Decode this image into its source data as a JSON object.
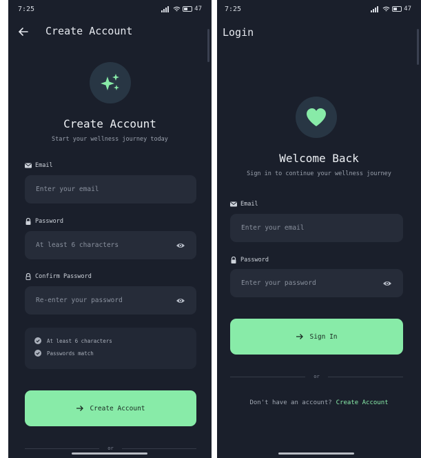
{
  "left": {
    "status": {
      "time": "7:25",
      "battery": "47"
    },
    "appbar": {
      "title": "Create Account"
    },
    "hero": {
      "title": "Create Account",
      "subtitle": "Start your wellness journey today"
    },
    "email": {
      "label": "Email",
      "placeholder": "Enter your email"
    },
    "password": {
      "label": "Password",
      "placeholder": "At least 6 characters"
    },
    "confirm": {
      "label": "Confirm Password",
      "placeholder": "Re-enter your password"
    },
    "requirements": [
      {
        "text": "At least 6 characters"
      },
      {
        "text": "Passwords match"
      }
    ],
    "primary_button": {
      "label": "Create Account"
    },
    "divider": "or"
  },
  "right": {
    "status": {
      "time": "7:25",
      "battery": "47"
    },
    "appbar": {
      "title": "Login"
    },
    "hero": {
      "title": "Welcome Back",
      "subtitle": "Sign in to continue your wellness journey"
    },
    "email": {
      "label": "Email",
      "placeholder": "Enter your email"
    },
    "password": {
      "label": "Password",
      "placeholder": "Enter your password"
    },
    "primary_button": {
      "label": "Sign In"
    },
    "divider": "or",
    "footer": {
      "prompt": "Don't have an account?",
      "link": "Create Account"
    }
  },
  "colors": {
    "background": "#1a1f2b",
    "field": "#262c39",
    "accent": "#88eba8",
    "icon_circle": "#283644"
  },
  "icons": [
    "back-arrow-icon",
    "sparkles-icon",
    "heart-icon",
    "mail-icon",
    "lock-icon",
    "eye-icon",
    "check-circle-icon",
    "arrow-right-icon",
    "wifi-icon",
    "signal-icon",
    "battery-icon"
  ]
}
